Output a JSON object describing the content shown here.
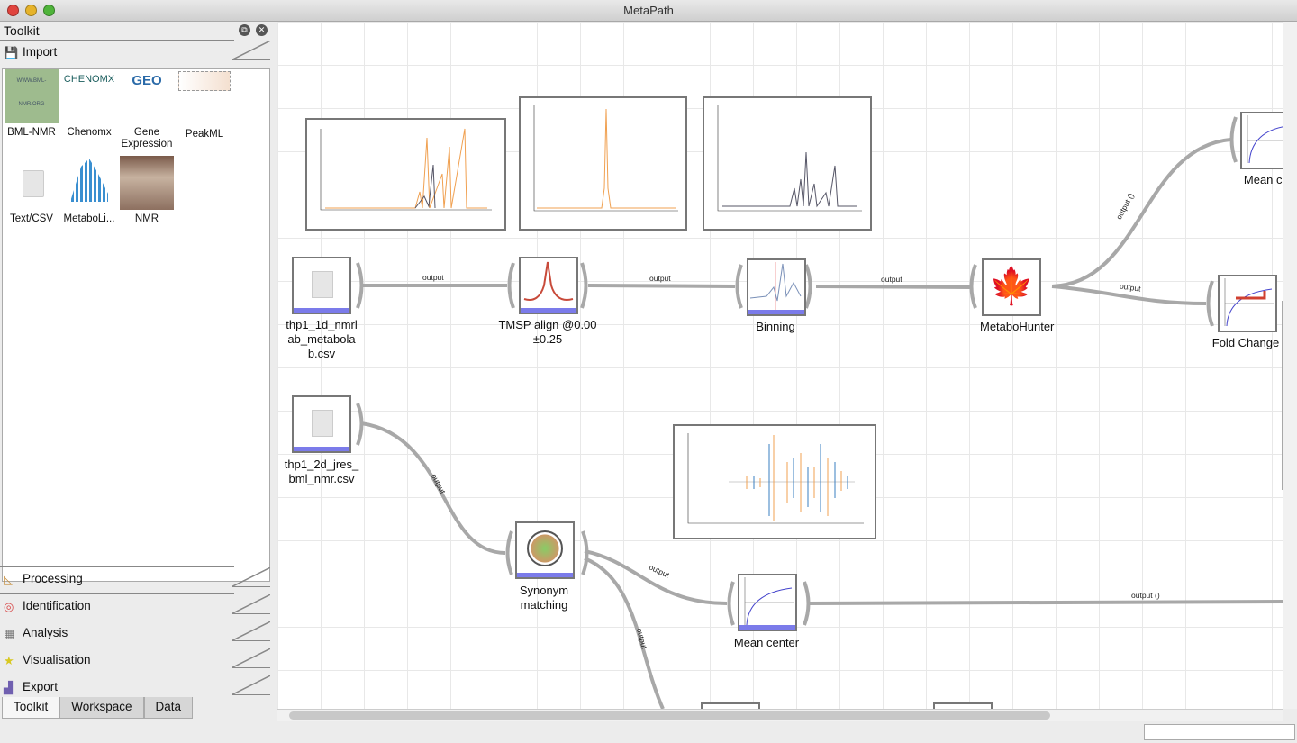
{
  "window": {
    "title": "MetaPath"
  },
  "toolkit": {
    "title": "Toolkit",
    "sections": [
      {
        "label": "Import",
        "icon": "save-disk-icon"
      },
      {
        "label": "Processing",
        "icon": "set-square-icon"
      },
      {
        "label": "Identification",
        "icon": "target-icon"
      },
      {
        "label": "Analysis",
        "icon": "calculator-icon"
      },
      {
        "label": "Visualisation",
        "icon": "star-icon"
      },
      {
        "label": "Export",
        "icon": "export-chart-icon"
      }
    ],
    "import_tools": [
      {
        "label": "BML-NMR"
      },
      {
        "label": "Chenomx",
        "logo": "CHENOMX"
      },
      {
        "label": "Gene Expression",
        "logo": "GEO"
      },
      {
        "label": "PeakML"
      },
      {
        "label": "Text/CSV"
      },
      {
        "label": "MetaboLi..."
      },
      {
        "label": "NMR"
      }
    ],
    "bottom_tabs": [
      "Toolkit",
      "Workspace",
      "Data"
    ],
    "active_tab": "Toolkit"
  },
  "workflow": {
    "nodes": [
      {
        "label": "thp1_1d_nmrlab_metabolab.csv",
        "icon": "file-icon"
      },
      {
        "label": "TMSP align @0.00 ±0.25",
        "icon": "peak-icon"
      },
      {
        "label": "Binning",
        "icon": "spectrum-icon"
      },
      {
        "label": "MetaboHunter",
        "icon": "maple-leaf-icon"
      },
      {
        "label": "Mean cer",
        "icon": "curve-icon"
      },
      {
        "label": "Fold Change",
        "icon": "fold-change-icon"
      },
      {
        "label": "thp1_2d_jres_bml_nmr.csv",
        "icon": "file-icon"
      },
      {
        "label": "Synonym matching",
        "icon": "synonym-icon"
      },
      {
        "label": "Mean center",
        "icon": "curve-icon"
      }
    ],
    "edges": [
      "output",
      "output",
      "output",
      "output ()",
      "output",
      "output",
      "output",
      "output",
      "output ()"
    ]
  },
  "colors": {
    "accent_bar": "#7b7bea",
    "edge": "#a8a8a8",
    "spectrum_orange": "#f0a050",
    "spectrum_blue": "#3a7fc0"
  }
}
